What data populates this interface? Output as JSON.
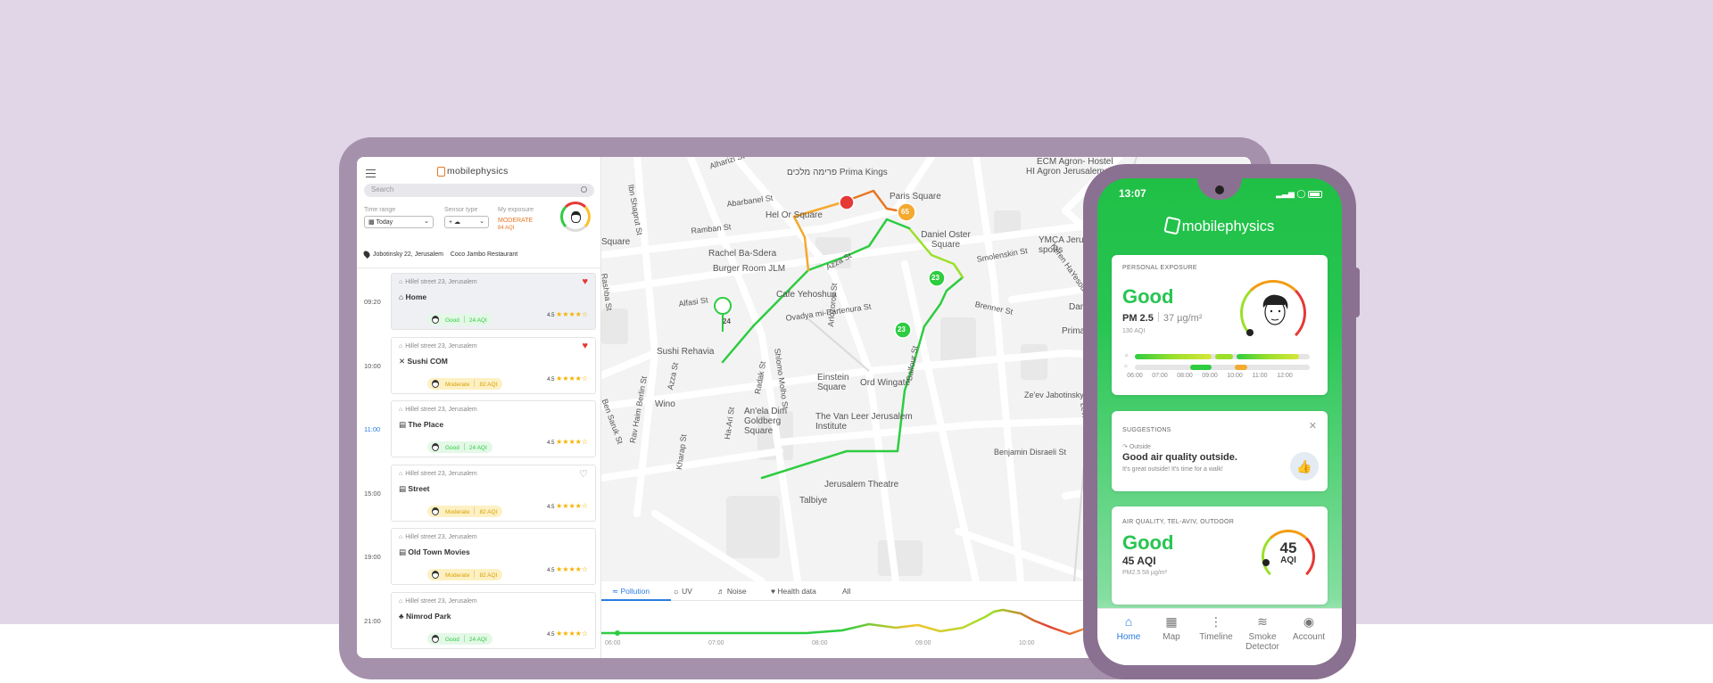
{
  "colors": {
    "background": "#e1d5e8",
    "good": "#27c552",
    "moderate": "#e87722",
    "accent": "#2a7de1",
    "bad": "#e53935",
    "warn": "#f4a92f"
  },
  "tablet": {
    "brand": "mobilephysics",
    "search_placeholder": "Search",
    "filters": {
      "time_range_label": "Time range",
      "time_range_value": "Today",
      "sensor_type_label": "Sensor type",
      "sensor_type_value": "+ ☁",
      "exposure_label": "My exposure",
      "exposure_value": "MODERATE",
      "exposure_aqi": "84 AQI"
    },
    "route": {
      "from": "Jobotinsky 22, Jerusalem",
      "to": "Coco Jambo Restaurant"
    },
    "timeline": [
      {
        "time": "09:20",
        "address": "Hillel street 23, Jerusalem",
        "name": "Home",
        "icon": "home-icon",
        "quality": "Good",
        "aqi": "24 AQI",
        "rating": "4.5",
        "favorite": true,
        "selected": true
      },
      {
        "time": "10:00",
        "address": "Hillel street 23, Jerusalem",
        "name": "Sushi COM",
        "icon": "restaurant-icon",
        "quality": "Moderate",
        "aqi": "82 AQI",
        "rating": "4.5",
        "favorite": true
      },
      {
        "time": "11:00",
        "address": "Hillel street 23, Jerusalem",
        "name": "The Place",
        "icon": "building-icon",
        "quality": "Good",
        "aqi": "24 AQI",
        "rating": "4.5",
        "current": true
      },
      {
        "time": "15:00",
        "address": "Hillel street 23, Jerusalem",
        "name": "Street",
        "icon": "building-icon",
        "quality": "Moderate",
        "aqi": "82 AQI",
        "rating": "4.5",
        "favorite": false
      },
      {
        "time": "19:00",
        "address": "Hillel street 23, Jerusalem",
        "name": "Old Town Movies",
        "icon": "building-icon",
        "quality": "Moderate",
        "aqi": "82 AQI",
        "rating": "4.5"
      },
      {
        "time": "21:00",
        "address": "Hillel street 23, Jerusalem",
        "name": "Nimrod Park",
        "icon": "park-icon",
        "quality": "Good",
        "aqi": "24 AQI",
        "rating": "4.5"
      }
    ],
    "map": {
      "streets": [
        "Alharizi St",
        "Ibn Shaprut St",
        "Abarbanel St",
        "Hel Or Square",
        "Ramban St",
        "Square",
        "Rachel Ba-Sdera",
        "Burger Room JLM",
        "Azza St",
        "Cafe Yehoshua",
        "Alfasi St",
        "Ovadya mi-Bartenura St",
        "Arlozorov St",
        "Sushi Rehavia",
        "Shlomo Molho St",
        "Radak St",
        "Azza St",
        "Wino",
        "Einstein Square",
        "Ord Wingate",
        "Balfour St",
        "An'ela Dim Goldberg Square",
        "The Van Leer Jerusalem Institute",
        "Ha-Ari St",
        "Ben Saruk St",
        "Rav Haim Berlin St",
        "Kharap St",
        "Jerusalem Theatre",
        "Talbiye",
        "Paris Square",
        "Daniel Oster Square",
        "Smolenskin St",
        "Brenner St",
        "Keren HaYesod St",
        "Ze'ev Jabotinsky St",
        "Benjamin Disraeli St",
        "Levi Hamlet St",
        "Rashba St",
        "Dan Panorama",
        "Prima Royale",
        "YMCA Jerusalem sports",
        "ECM Agron- Hostel",
        "HI Agron Jerusalem",
        "פרימה מלכים Prima Kings"
      ],
      "markers": [
        "24",
        "65",
        "23",
        "23"
      ]
    },
    "tabs": [
      "Pollution",
      "UV",
      "Noise",
      "Health data",
      "All"
    ],
    "chart_hours": [
      "06:00",
      "07:00",
      "08:00",
      "09:00",
      "10:00"
    ]
  },
  "phone": {
    "time": "13:07",
    "brand": "mobilephysics",
    "exposure": {
      "title": "PERSONAL EXPOSURE",
      "status": "Good",
      "pollutant": "PM 2.5",
      "value": "37 µg/m²",
      "aqi": "130 AQI",
      "hours": [
        "06:00",
        "07:00",
        "08:00",
        "09:00",
        "10:00",
        "11:00",
        "12:00"
      ]
    },
    "suggestion": {
      "title": "SUGGESTIONS",
      "context": "Outside",
      "headline": "Good air quality outside.",
      "detail": "It's great outside! It's time for a walk!"
    },
    "air_quality": {
      "title": "AIR QUALITY, TEL-AVIV, OUTDOOR",
      "status": "Good",
      "aqi_text": "45 AQI",
      "detail": "PM2.5 58 µg/m²",
      "gauge_value": "45",
      "gauge_unit": "AQI"
    },
    "nav": [
      {
        "label": "Home",
        "icon": "home-icon",
        "active": true
      },
      {
        "label": "Map",
        "icon": "map-icon"
      },
      {
        "label": "Timeline",
        "icon": "timeline-icon"
      },
      {
        "label": "Smoke Detector",
        "icon": "smoke-icon"
      },
      {
        "label": "Account",
        "icon": "account-icon"
      }
    ]
  }
}
